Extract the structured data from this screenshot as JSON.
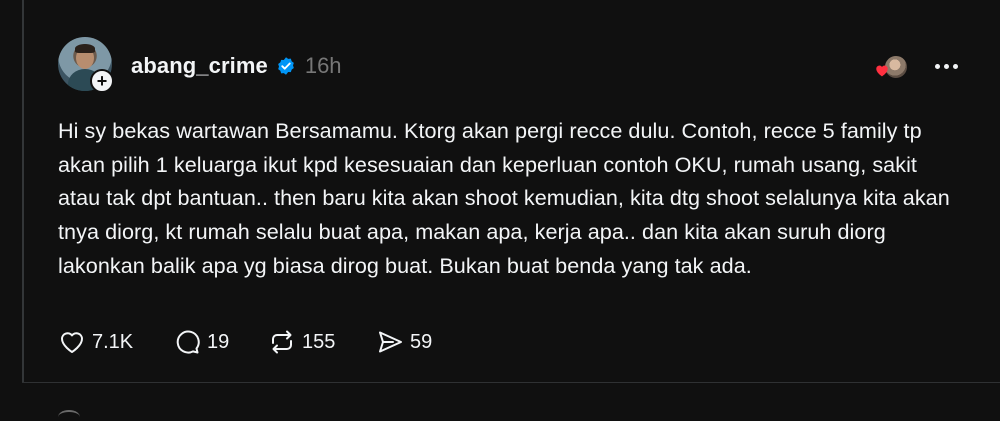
{
  "post": {
    "username": "abang_crime",
    "verified": true,
    "time": "16h",
    "text": "Hi sy bekas wartawan Bersamamu. Ktorg akan pergi recce dulu. Contoh, recce 5 family tp akan pilih 1 keluarga ikut kpd kesesuaian dan keperluan contoh OKU, rumah usang, sakit atau tak dpt bantuan.. then baru kita akan shoot kemudian, kita dtg shoot selalunya kita akan tnya diorg, kt rumah selalu buat apa, makan apa, kerja apa.. dan kita akan suruh diorg lakonkan balik apa yg biasa dirog buat. Bukan buat benda yang tak ada.",
    "actions": {
      "likes": "7.1K",
      "replies": "19",
      "reposts": "155",
      "shares": "59"
    }
  },
  "colors": {
    "background": "#101010",
    "text": "#f3f5f7",
    "muted": "#777777",
    "verified": "#0095f6",
    "heart": "#ff3040"
  },
  "icons": {
    "like": "heart-icon",
    "reply": "comment-icon",
    "repost": "repost-icon",
    "share": "send-icon",
    "more": "more-icon",
    "verified": "verified-badge-icon",
    "follow": "plus-icon"
  }
}
